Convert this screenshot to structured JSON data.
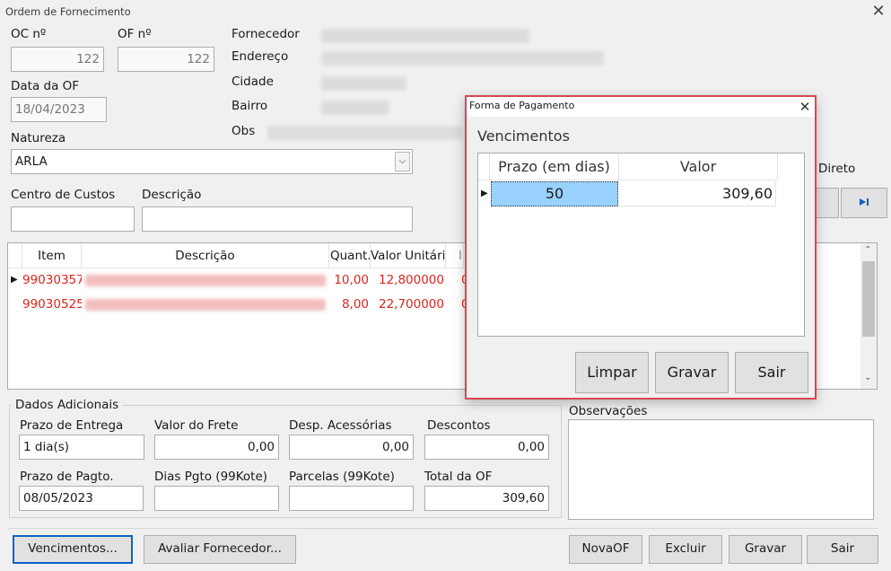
{
  "window": {
    "title": "Ordem de Fornecimento",
    "close": "✕"
  },
  "form": {
    "oc_label": "OC nº",
    "oc_value": "122",
    "of_label": "OF nº",
    "of_value": "122",
    "date_label": "Data da OF",
    "date_value": "18/04/2023",
    "natureza_label": "Natureza",
    "natureza_value": "ARLA",
    "centro_label": "Centro de Custos",
    "centro_value": "",
    "descricao_label": "Descrição",
    "descricao_value": "",
    "fornecedor_label": "Fornecedor",
    "endereco_label": "Endereço",
    "cidade_label": "Cidade",
    "bairro_label": "Bairro",
    "obs_label": "Obs",
    "direto_label": "Direto"
  },
  "items_grid": {
    "columns": [
      "Item",
      "Descrição",
      "Quant.",
      "Valor Unitário",
      "I"
    ],
    "rows": [
      {
        "item": "99030357",
        "quant": "10,00",
        "valor": "12,800000",
        "extra": "0"
      },
      {
        "item": "99030525",
        "quant": "8,00",
        "valor": "22,700000",
        "extra": "0"
      }
    ]
  },
  "dados_adicionais": {
    "title": "Dados Adicionais",
    "prazo_entrega_label": "Prazo de Entrega",
    "prazo_entrega_value": "1 dia(s)",
    "valor_frete_label": "Valor do Frete",
    "valor_frete_value": "0,00",
    "desp_label": "Desp. Acessórias",
    "desp_value": "0,00",
    "descontos_label": "Descontos",
    "descontos_value": "0,00",
    "prazo_pagto_label": "Prazo de Pagto.",
    "prazo_pagto_value": "08/05/2023",
    "dias_pgto_label": "Dias Pgto (99Kote)",
    "dias_pgto_value": "",
    "parcelas_label": "Parcelas (99Kote)",
    "parcelas_value": "",
    "total_label": "Total da OF",
    "total_value": "309,60"
  },
  "observacoes_label": "Observações",
  "bottom_buttons": {
    "vencimentos": "Vencimentos...",
    "avaliar": "Avaliar Fornecedor...",
    "novaof": "NovaOF",
    "excluir": "Excluir",
    "gravar": "Gravar",
    "sair": "Sair"
  },
  "dialog": {
    "title": "Forma de Pagamento",
    "close": "✕",
    "section": "Vencimentos",
    "columns": [
      "Prazo (em dias)",
      "Valor"
    ],
    "rows": [
      {
        "prazo": "50",
        "valor": "309,60"
      }
    ],
    "buttons": {
      "limpar": "Limpar",
      "gravar": "Gravar",
      "sair": "Sair"
    }
  },
  "icons": {
    "row_pointer": "triangle-right-icon",
    "last_record": "skip-last-icon",
    "scroll_down": "chevron-down-icon",
    "scroll_up": "chevron-up-icon",
    "combo": "chevron-down-icon"
  },
  "colors": {
    "dialog_border": "#d9474f",
    "selected_cell": "#99d1ff",
    "row_text": "#e0231b",
    "focus_border": "#0a64c8"
  }
}
